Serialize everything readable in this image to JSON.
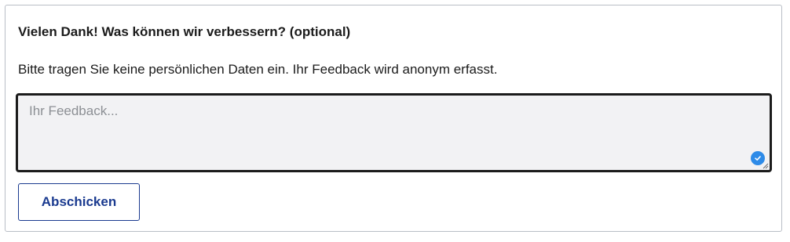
{
  "feedback": {
    "title": "Vielen Dank! Was können wir verbessern? (optional)",
    "note": "Bitte tragen Sie keine persönlichen Daten ein. Ihr Feedback wird anonym erfasst.",
    "input": {
      "placeholder": "Ihr Feedback...",
      "value": ""
    },
    "status_icon": "check-circle-icon",
    "submit_label": "Abschicken"
  },
  "colors": {
    "accent": "#1a3a8f",
    "status": "#2e8be8",
    "input_background": "#f2f2f4",
    "border": "#b9bec6"
  }
}
